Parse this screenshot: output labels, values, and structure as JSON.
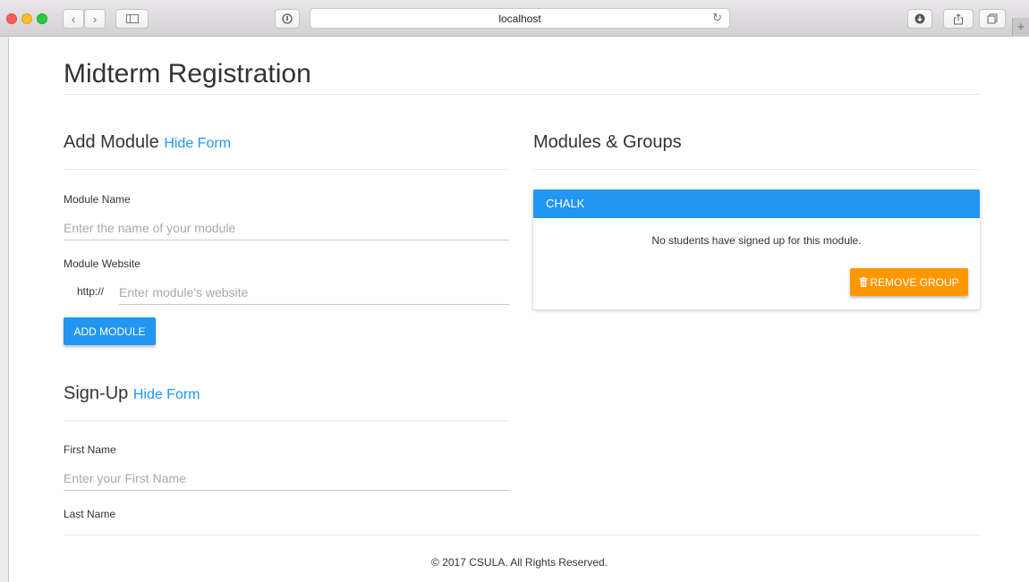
{
  "browser": {
    "url": "localhost",
    "back_icon": "chevron-left-icon",
    "forward_icon": "chevron-right-icon"
  },
  "page": {
    "title": "Midterm Registration"
  },
  "add_module": {
    "heading": "Add Module",
    "toggle_label": "Hide Form",
    "module_name_label": "Module Name",
    "module_name_placeholder": "Enter the name of your module",
    "module_website_label": "Module Website",
    "website_prefix": "http://",
    "module_website_placeholder": "Enter module's website",
    "submit_label": "ADD MODULE"
  },
  "signup": {
    "heading": "Sign-Up",
    "toggle_label": "Hide Form",
    "first_name_label": "First Name",
    "first_name_placeholder": "Enter your First Name",
    "last_name_label": "Last Name"
  },
  "modules_groups": {
    "heading": "Modules & Groups",
    "groups": [
      {
        "name": "CHALK",
        "message": "No students have signed up for this module.",
        "remove_label": "REMOVE GROUP"
      }
    ]
  },
  "footer": {
    "text": "© 2017 CSULA. All Rights Reserved."
  },
  "colors": {
    "primary": "#2196f3",
    "warning": "#ff9800"
  }
}
